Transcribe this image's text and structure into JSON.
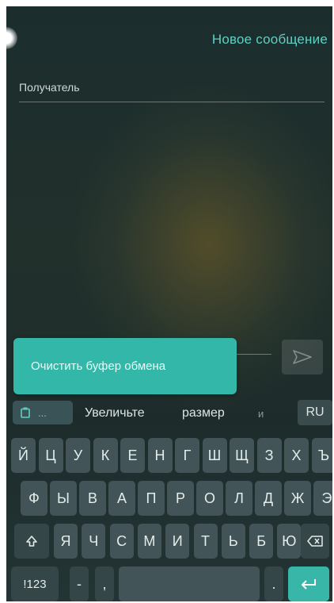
{
  "header": {
    "title": "Новое сообщение"
  },
  "recipient": {
    "label": "Получатель"
  },
  "clipboard_popup": {
    "label": "Очистить буфер обмена"
  },
  "suggestions": {
    "clipboard_chip": "...",
    "words": [
      "Увеличьте",
      "размер",
      "и"
    ],
    "language": "RU"
  },
  "keyboard": {
    "row1": [
      "Й",
      "Ц",
      "У",
      "К",
      "Е",
      "Н",
      "Г",
      "Ш",
      "Щ",
      "З",
      "Х",
      "Ъ"
    ],
    "row2": [
      "Ф",
      "Ы",
      "В",
      "А",
      "П",
      "Р",
      "О",
      "Л",
      "Д",
      "Ж",
      "Э"
    ],
    "row3": [
      "Я",
      "Ч",
      "С",
      "М",
      "И",
      "Т",
      "Ь",
      "Б",
      "Ю"
    ],
    "symbols_label": "!123",
    "dash_label": "-",
    "comma_label": ",",
    "period_label": "."
  },
  "icons": {
    "shift": "shift-icon",
    "backspace": "backspace-icon",
    "enter": "enter-icon",
    "send": "send-icon",
    "clipboard": "clipboard-icon"
  },
  "colors": {
    "accent": "#38b6a7",
    "title": "#5fd0c4",
    "key": "#425457"
  }
}
